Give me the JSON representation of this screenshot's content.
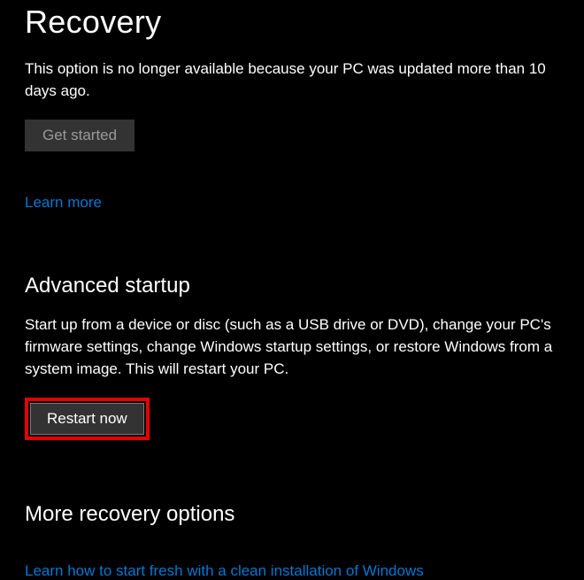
{
  "recovery": {
    "title": "Recovery",
    "unavailable_text": "This option is no longer available because your PC was updated more than 10 days ago.",
    "get_started_label": "Get started",
    "learn_more_label": "Learn more"
  },
  "advanced_startup": {
    "title": "Advanced startup",
    "description": "Start up from a device or disc (such as a USB drive or DVD), change your PC's firmware settings, change Windows startup settings, or restore Windows from a system image. This will restart your PC.",
    "restart_now_label": "Restart now"
  },
  "more_recovery": {
    "title": "More recovery options",
    "fresh_install_link": "Learn how to start fresh with a clean installation of Windows"
  }
}
